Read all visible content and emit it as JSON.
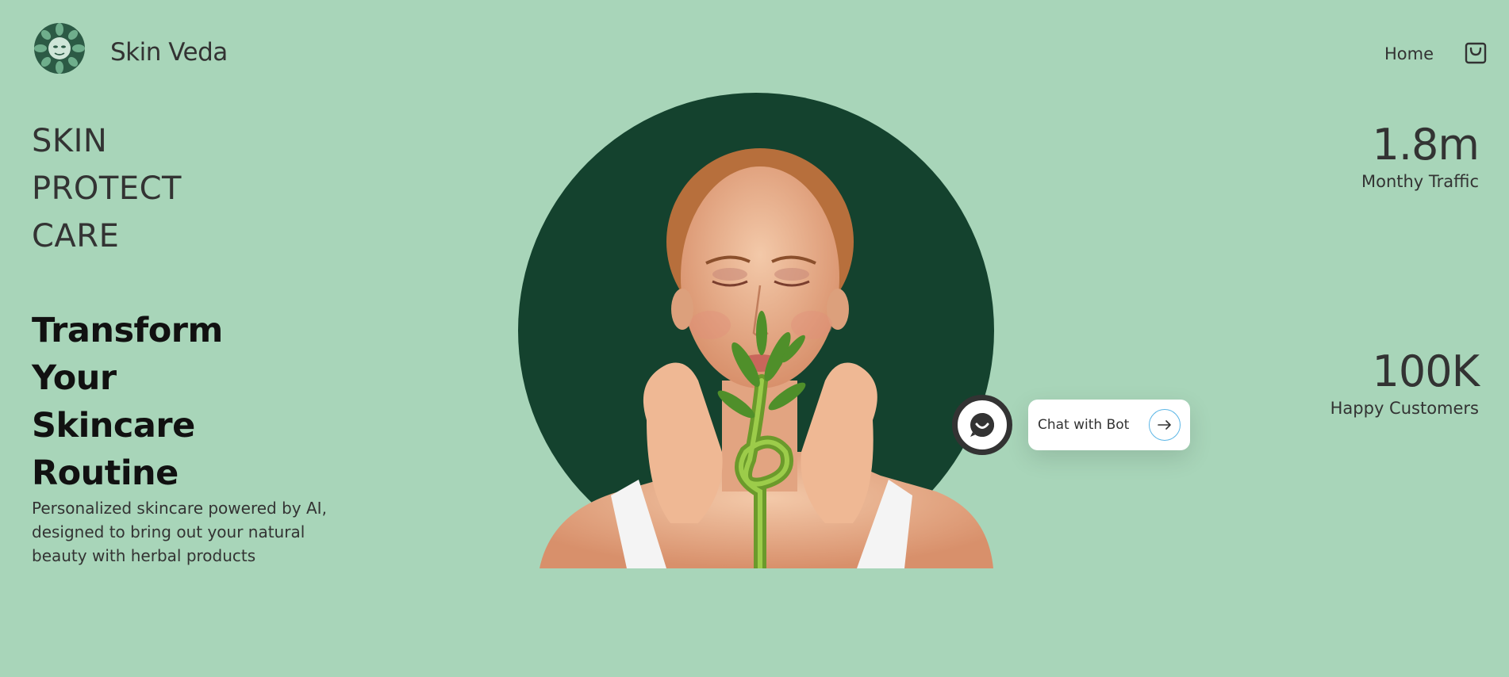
{
  "header": {
    "brand": "Skin Veda",
    "nav": {
      "home_label": "Home"
    },
    "logo_icon": "leaf-mandala-logo",
    "cart_icon": "shopping-bag-icon"
  },
  "hero": {
    "taglines": [
      "SKIN",
      "PROTECT",
      "CARE"
    ],
    "headline": [
      "Transform",
      "Your",
      "Skincare",
      "Routine"
    ],
    "description": "Personalized skincare powered by AI, designed to bring out your natural beauty with herbal products",
    "image": "woman-with-bamboo-plant"
  },
  "stats": [
    {
      "value": "1.8m",
      "label": "Monthy Traffic"
    },
    {
      "value": "100K",
      "label": "Happy Customers"
    }
  ],
  "chat": {
    "label": "Chat with Bot",
    "avatar_icon": "smile-chat-icon",
    "arrow_icon": "arrow-right-icon"
  },
  "colors": {
    "background": "#a8d5b9",
    "circle": "#14422e",
    "text": "#333333",
    "accent": "#5bb6e6"
  }
}
